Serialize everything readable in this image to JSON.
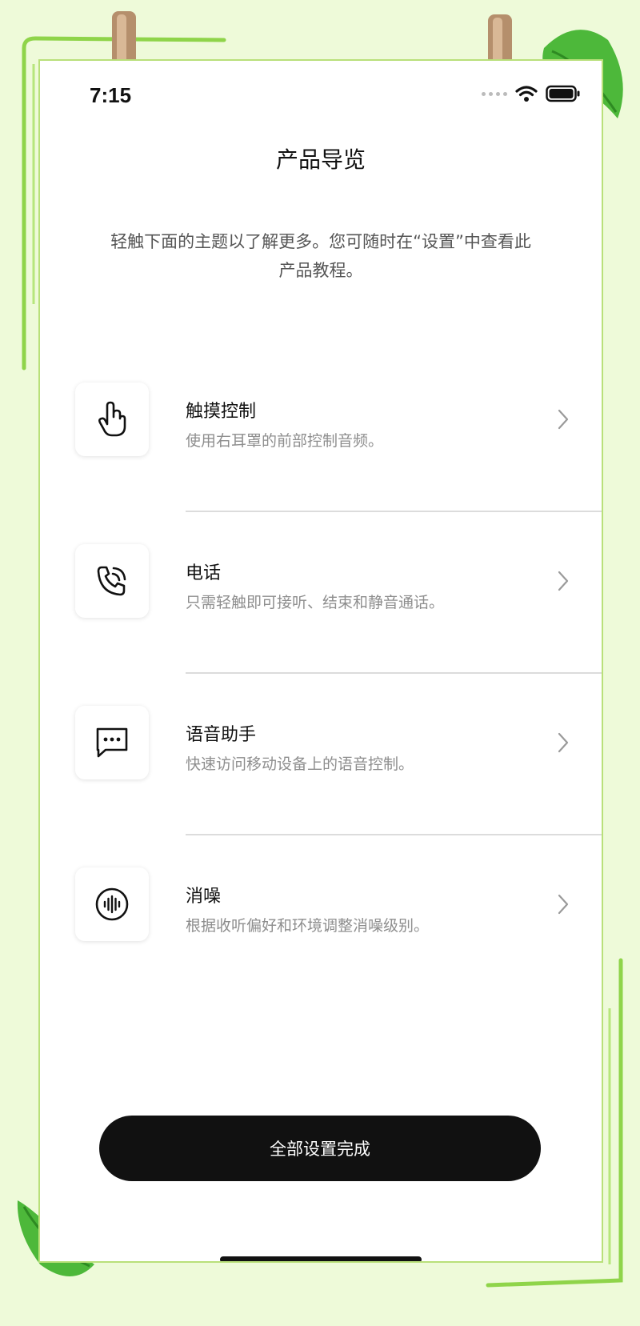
{
  "status_bar": {
    "time": "7:15"
  },
  "header": {
    "title": "产品导览"
  },
  "intro": {
    "line1": "轻触下面的主题以了解更多。您可随时在“设置”中查看此",
    "line2": "产品教程。"
  },
  "items": [
    {
      "icon": "touch-hand-icon",
      "title": "触摸控制",
      "subtitle": "使用右耳罩的前部控制音频。"
    },
    {
      "icon": "phone-call-icon",
      "title": "电话",
      "subtitle": "只需轻触即可接听、结束和静音通话。"
    },
    {
      "icon": "chat-bubble-icon",
      "title": "语音助手",
      "subtitle": "快速访问移动设备上的语音控制。"
    },
    {
      "icon": "sound-wave-icon",
      "title": "消噪",
      "subtitle": "根据收听偏好和环境调整消噪级别。"
    }
  ],
  "cta": {
    "label": "全部设置完成"
  },
  "colors": {
    "background": "#eefad9",
    "button": "#111111",
    "button_text": "#ffffff"
  }
}
